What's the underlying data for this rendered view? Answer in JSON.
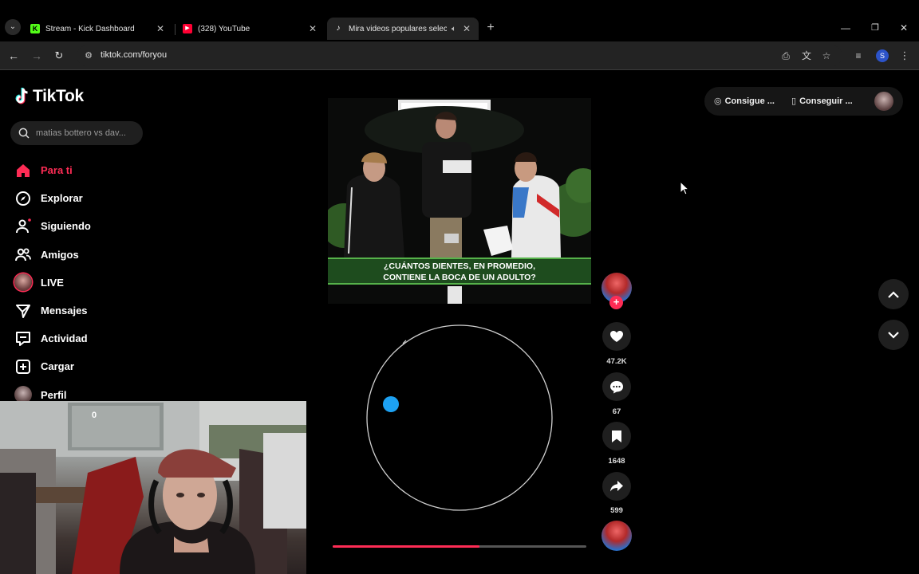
{
  "browser": {
    "tabs": [
      {
        "title": "Stream - Kick Dashboard",
        "favicon": "kick-logo",
        "color": "#53fc18"
      },
      {
        "title": "(328) YouTube",
        "favicon": "youtube-logo",
        "color": "#ff0033"
      },
      {
        "title": "Mira videos populares selec",
        "favicon": "tiktok-logo",
        "color": "#ffffff",
        "active": true
      }
    ],
    "url": "tiktok.com/foryou",
    "profile_initial": "S"
  },
  "tiktok": {
    "brand": "TikTok",
    "search_placeholder": "matias bottero vs dav...",
    "nav": [
      {
        "label": "Para ti",
        "icon": "home-icon",
        "active": true
      },
      {
        "label": "Explorar",
        "icon": "compass-icon"
      },
      {
        "label": "Siguiendo",
        "icon": "following-icon"
      },
      {
        "label": "Amigos",
        "icon": "friends-icon"
      },
      {
        "label": "LIVE",
        "icon": "live-avatar-icon"
      },
      {
        "label": "Mensajes",
        "icon": "messages-icon"
      },
      {
        "label": "Actividad",
        "icon": "activity-icon"
      },
      {
        "label": "Cargar",
        "icon": "upload-icon"
      },
      {
        "label": "Perfil",
        "icon": "profile-avatar-icon"
      }
    ],
    "header": {
      "coins_label": "Consigue ...",
      "app_label": "Conseguir ..."
    },
    "video": {
      "caption_line1": "¿CUÁNTOS DIENTES, EN PROMEDIO,",
      "caption_line2": "CONTIENE LA BOCA DE UN ADULTO?",
      "progress": 0.58
    },
    "actions": {
      "likes": "47.2K",
      "comments": "67",
      "saves": "1648",
      "shares": "599"
    },
    "webcam_overlay": "0"
  },
  "colors": {
    "accent": "#fe2c55",
    "caption_green": "#1e4c1e",
    "loading_dot": "#1da1f2"
  }
}
